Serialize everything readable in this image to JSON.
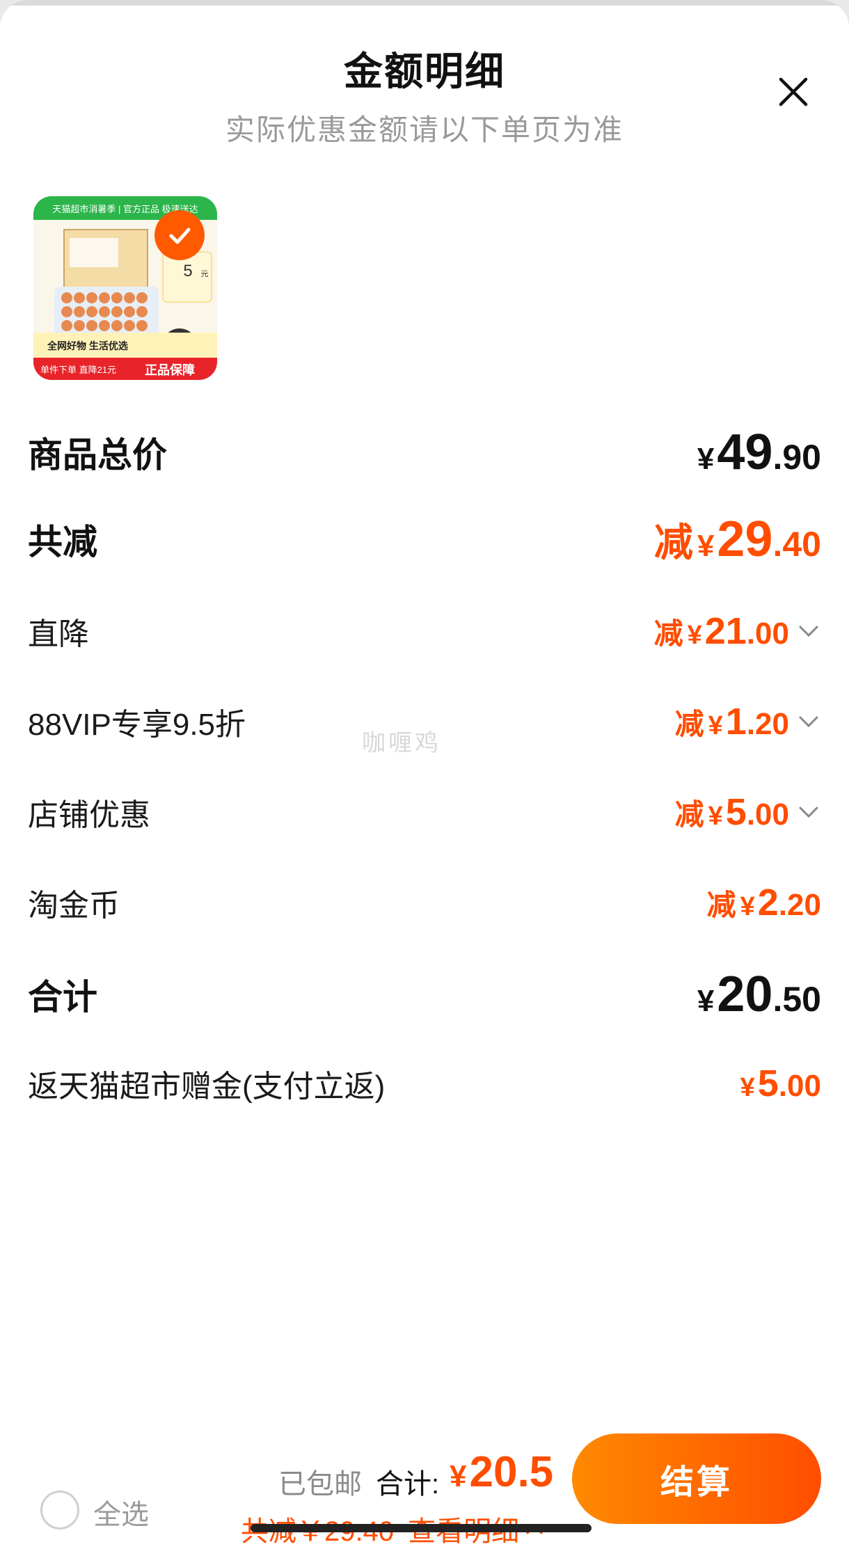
{
  "header": {
    "title": "金额明细",
    "subtitle": "实际优惠金额请以下单页为准"
  },
  "product": {
    "image_text": {
      "top_banner": "天猫超市消暑季 | 官方正品 极速送达",
      "price_tag_unit": "元",
      "price_tag_num": "5",
      "promo_line1": "全网好物 生活优选",
      "promo_line2": "单件下单 直降21元",
      "promo_badge": "正品保障"
    },
    "selected": true
  },
  "rows": [
    {
      "label": "商品总价",
      "prefix": "",
      "currency": "¥",
      "int": "49",
      "dec": ".90",
      "style": "black-bold",
      "chevron": false
    },
    {
      "label": "共减",
      "prefix": "减",
      "currency": "¥",
      "int": "29",
      "dec": ".40",
      "style": "orange-bold",
      "chevron": false
    },
    {
      "label": "直降",
      "prefix": "减",
      "currency": "¥",
      "int": "21",
      "dec": ".00",
      "style": "orange",
      "chevron": true
    },
    {
      "label": "88VIP专享9.5折",
      "prefix": "减",
      "currency": "¥",
      "int": "1",
      "dec": ".20",
      "style": "orange",
      "chevron": true
    },
    {
      "label": "店铺优惠",
      "prefix": "减",
      "currency": "¥",
      "int": "5",
      "dec": ".00",
      "style": "orange",
      "chevron": true
    },
    {
      "label": "淘金币",
      "prefix": "减",
      "currency": "¥",
      "int": "2",
      "dec": ".20",
      "style": "orange",
      "chevron": false
    },
    {
      "label": "合计",
      "prefix": "",
      "currency": "¥",
      "int": "20",
      "dec": ".50",
      "style": "black-bold",
      "chevron": false
    },
    {
      "label": "返天猫超市赠金(支付立返)",
      "prefix": "",
      "currency": "¥",
      "int": "5",
      "dec": ".00",
      "style": "orange",
      "chevron": false
    }
  ],
  "watermark": "咖喱鸡",
  "footer": {
    "select_all": "全选",
    "shipping": "已包邮",
    "total_label": "合计:",
    "total_currency": "¥",
    "total_value": "20.5",
    "savings_text": "共减￥29.40",
    "detail_link": "查看明细",
    "checkout_label": "结算"
  },
  "colors": {
    "accent": "#ff4d00",
    "checkout_gradient_start": "#ff8a00",
    "text": "#111111",
    "muted": "#9a9a9a"
  }
}
